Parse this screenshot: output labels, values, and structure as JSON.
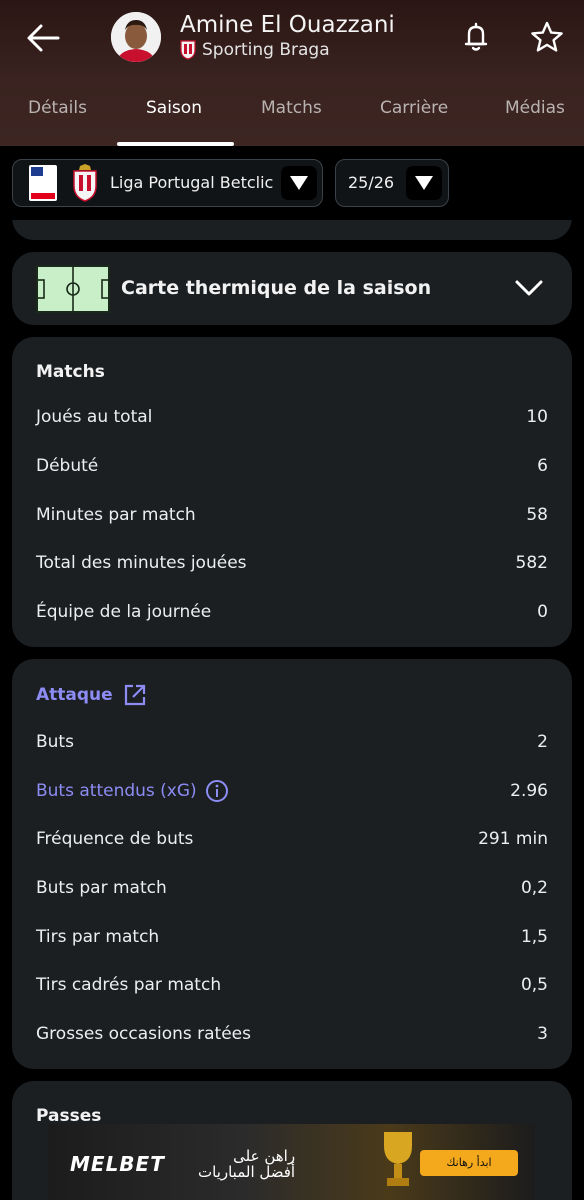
{
  "header": {
    "player_name": "Amine El Ouazzani",
    "club_name": "Sporting Braga"
  },
  "tabs": [
    {
      "label": "Détails"
    },
    {
      "label": "Saison"
    },
    {
      "label": "Matchs"
    },
    {
      "label": "Carrière"
    },
    {
      "label": "Médias"
    }
  ],
  "filters": {
    "league": "Liga Portugal Betclic",
    "season": "25/26",
    "league_logo_text_1": "LIGA",
    "league_logo_text_2": "PORTUGAL",
    "league_logo_text_3": "Betclic"
  },
  "heatmap": {
    "title": "Carte thermique de la saison"
  },
  "matchs": {
    "title": "Matchs",
    "rows": [
      {
        "label": "Joués au total",
        "value": "10"
      },
      {
        "label": "Débuté",
        "value": "6"
      },
      {
        "label": "Minutes par match",
        "value": "58"
      },
      {
        "label": "Total des minutes jouées",
        "value": "582"
      },
      {
        "label": "Équipe de la journée",
        "value": "0"
      }
    ]
  },
  "attaque": {
    "title": "Attaque",
    "rows": [
      {
        "label": "Buts",
        "value": "2"
      },
      {
        "label": "Buts attendus (xG)",
        "value": "2.96"
      },
      {
        "label": "Fréquence de buts",
        "value": "291 min"
      },
      {
        "label": "Buts par match",
        "value": "0,2"
      },
      {
        "label": "Tirs par match",
        "value": "1,5"
      },
      {
        "label": "Tirs cadrés par match",
        "value": "0,5"
      },
      {
        "label": "Grosses occasions ratées",
        "value": "3"
      }
    ]
  },
  "passes": {
    "title": "Passes"
  },
  "ad": {
    "brand": "MELBET",
    "line1": "راهن على",
    "line2": "أفضل المباريات",
    "cta": "ابدأ رهانك"
  },
  "colors": {
    "accent_link": "#8c8cf4",
    "card_bg": "#1b1f22",
    "header_bg": "#3a2320"
  }
}
